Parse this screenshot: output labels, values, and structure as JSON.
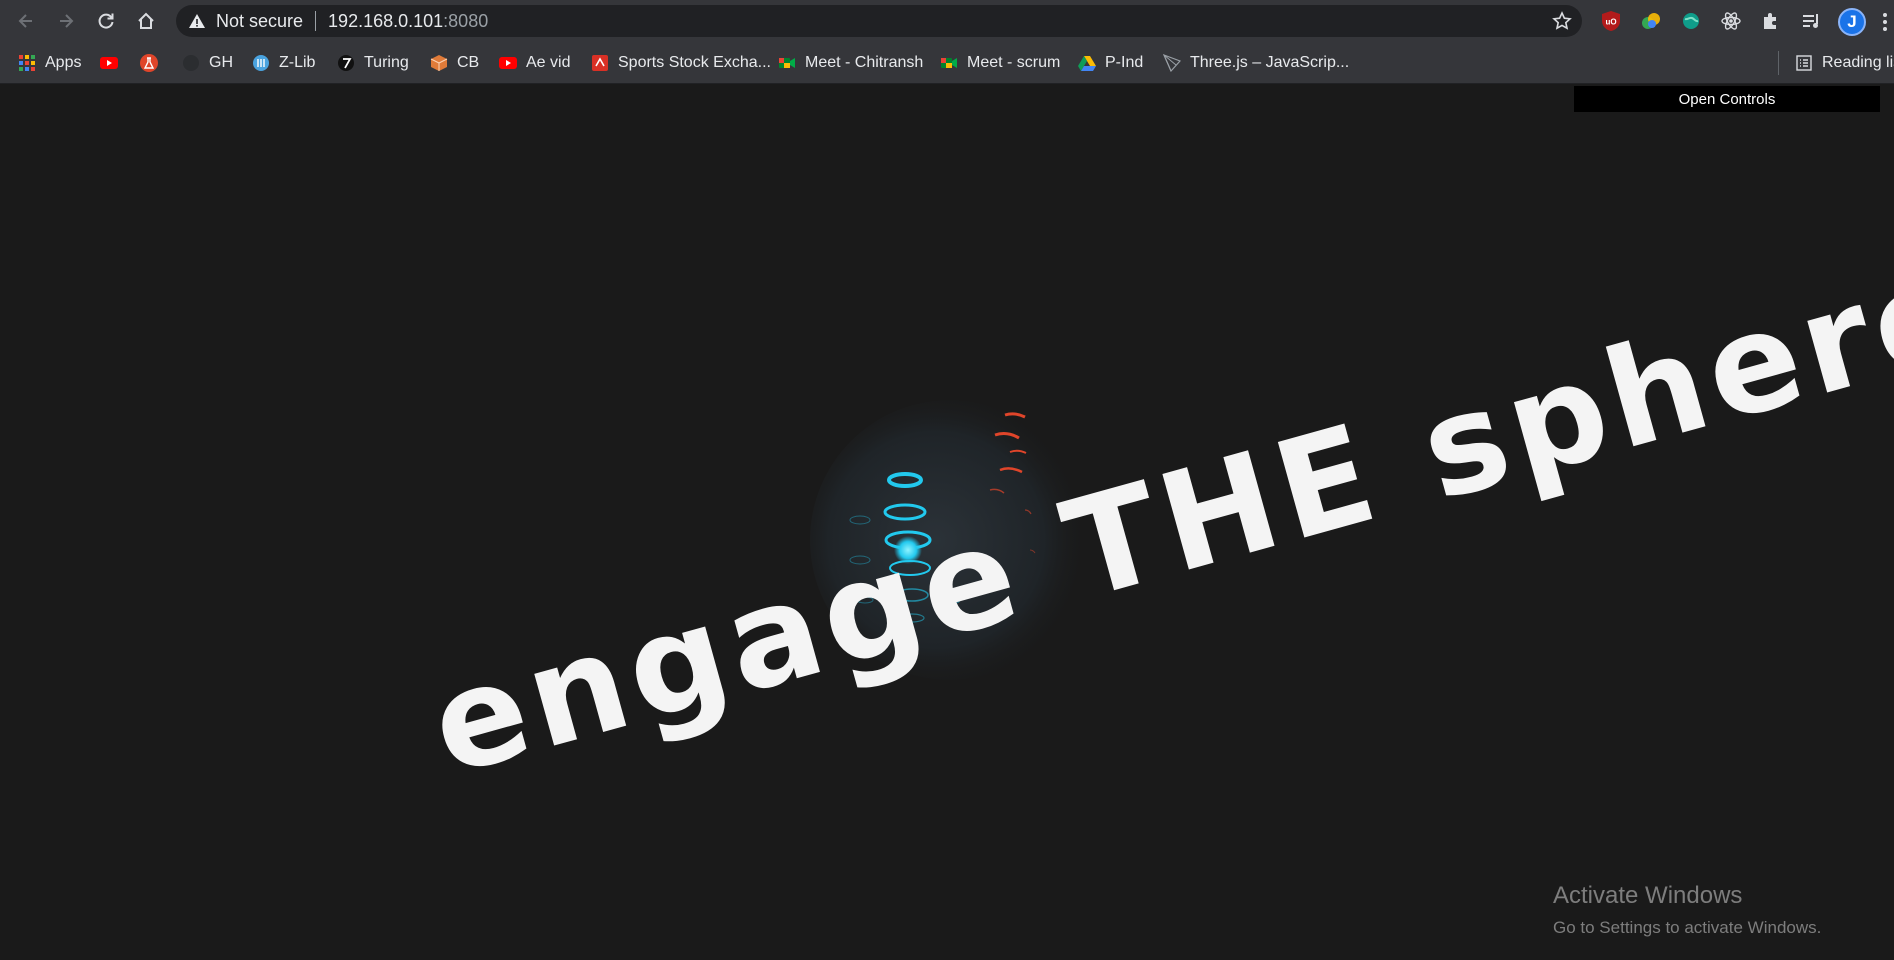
{
  "browser": {
    "security_label": "Not secure",
    "url_host": "192.168.0.101",
    "url_port": ":8080",
    "profile_initial": "J"
  },
  "bookmarks": [
    {
      "label": "Apps",
      "icon": "apps-grid-icon"
    },
    {
      "label": "",
      "icon": "youtube-icon"
    },
    {
      "label": "",
      "icon": "flask-icon"
    },
    {
      "label": "GH",
      "icon": "github-icon"
    },
    {
      "label": "Z-Lib",
      "icon": "zlib-icon"
    },
    {
      "label": "Turing",
      "icon": "turing-icon"
    },
    {
      "label": "CB",
      "icon": "cube-icon"
    },
    {
      "label": "Ae vid",
      "icon": "youtube-icon"
    },
    {
      "label": "Sports Stock Excha...",
      "icon": "sports-icon"
    },
    {
      "label": "Meet - Chitransh",
      "icon": "meet-icon"
    },
    {
      "label": "Meet - scrum",
      "icon": "meet-icon"
    },
    {
      "label": "P-Ind",
      "icon": "drive-icon"
    },
    {
      "label": "Three.js – JavaScrip...",
      "icon": "threejs-icon"
    },
    {
      "label": "Reading list",
      "icon": "reading-list-icon"
    }
  ],
  "page": {
    "controls_label": "Open Controls",
    "hero_text": "engage THE sphere"
  },
  "watermark": {
    "title": "Activate Windows",
    "subtitle": "Go to Settings to activate Windows."
  },
  "colors": {
    "page_bg": "#1a1a1a",
    "toolbar_bg": "#35363a",
    "accent_red": "#e0452a",
    "accent_cyan": "#22c9ee"
  }
}
